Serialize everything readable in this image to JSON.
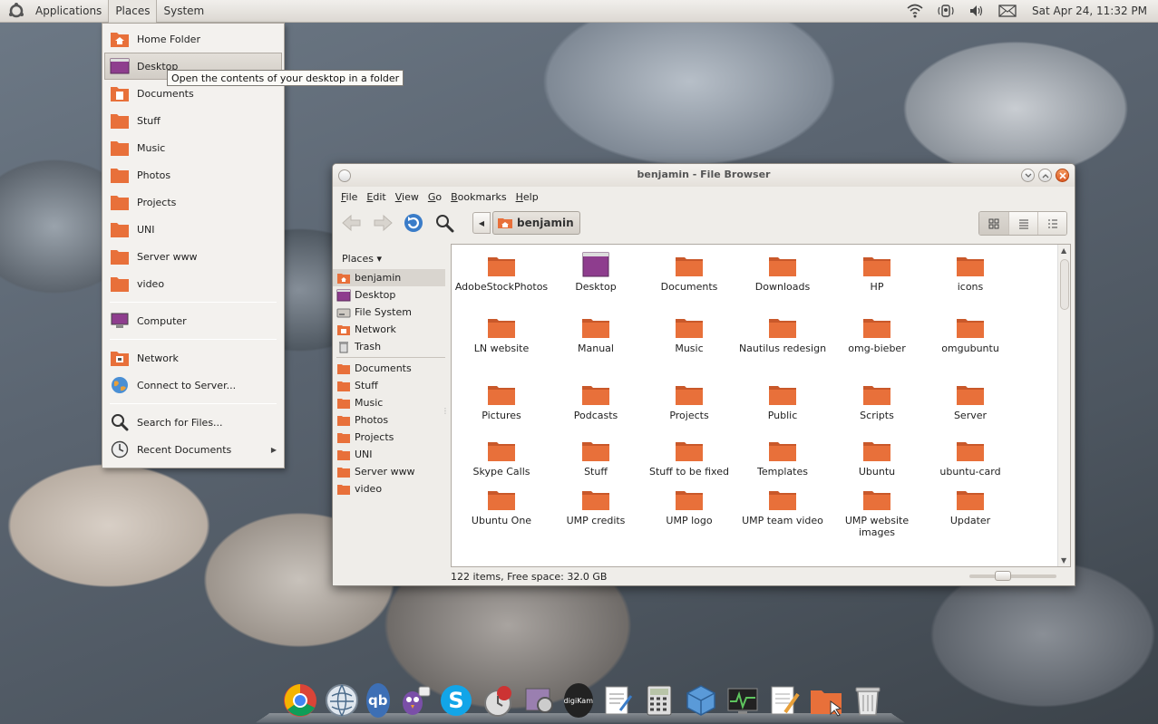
{
  "top_panel": {
    "menus": [
      "Applications",
      "Places",
      "System"
    ],
    "active_menu": "Places",
    "clock": "Sat Apr 24, 11:32 PM",
    "tray_icons": [
      "wifi-icon",
      "indicator-icon",
      "volume-icon",
      "mail-icon"
    ]
  },
  "places_menu": {
    "items": [
      {
        "label": "Home Folder",
        "icon": "home-folder-icon"
      },
      {
        "label": "Desktop",
        "icon": "desktop-icon"
      },
      {
        "label": "Documents",
        "icon": "folder-icon"
      },
      {
        "label": "Stuff",
        "icon": "folder-icon"
      },
      {
        "label": "Music",
        "icon": "folder-icon"
      },
      {
        "label": "Photos",
        "icon": "folder-icon"
      },
      {
        "label": "Projects",
        "icon": "folder-icon"
      },
      {
        "label": "UNI",
        "icon": "folder-icon"
      },
      {
        "label": "Server www",
        "icon": "folder-icon"
      },
      {
        "label": "video",
        "icon": "folder-icon"
      }
    ],
    "computer": "Computer",
    "network": "Network",
    "connect": "Connect to Server...",
    "search": "Search for Files...",
    "recent": "Recent Documents",
    "tooltip": "Open the contents of your desktop in a folder"
  },
  "file_browser": {
    "title": "benjamin - File Browser",
    "menubar": [
      {
        "key": "F",
        "rest": "ile"
      },
      {
        "key": "E",
        "rest": "dit"
      },
      {
        "key": "V",
        "rest": "iew"
      },
      {
        "key": "G",
        "rest": "o"
      },
      {
        "key": "B",
        "rest": "ookmarks"
      },
      {
        "key": "H",
        "rest": "elp"
      }
    ],
    "path": "benjamin",
    "side_header": "Places",
    "side_places": [
      "benjamin",
      "Desktop",
      "File System",
      "Network",
      "Trash"
    ],
    "side_bookmarks": [
      "Documents",
      "Stuff",
      "Music",
      "Photos",
      "Projects",
      "UNI",
      "Server www",
      "video"
    ],
    "status": "122 items, Free space: 32.0 GB",
    "files": [
      "AdobeStockPhotos",
      "Desktop",
      "Documents",
      "Downloads",
      "HP",
      "icons",
      "LN website",
      "Manual",
      "Music",
      "Nautilus redesign",
      "omg-bieber",
      "omgubuntu",
      "Pictures",
      "Podcasts",
      "Projects",
      "Public",
      "Scripts",
      "Server",
      "Skype Calls",
      "Stuff",
      "Stuff to be fixed",
      "Templates",
      "Ubuntu",
      "ubuntu-card",
      "Ubuntu One",
      "UMP credits",
      "UMP logo",
      "UMP team video",
      "UMP website images",
      "Updater"
    ]
  },
  "dock": {
    "apps": [
      "chrome-icon",
      "network-globe-icon",
      "qbittorrent-icon",
      "pidgin-icon",
      "skype-icon",
      "clock-app-icon",
      "screenshot-icon",
      "digikam-icon",
      "text-editor-icon",
      "calculator-icon",
      "virtualbox-icon",
      "system-monitor-icon",
      "notes-icon",
      "file-manager-icon",
      "trash-icon"
    ],
    "qb_label": "qb",
    "digikam_label": "digiKam"
  },
  "colors": {
    "folder_orange": "#e8703a",
    "desktop_purple": "#8e3d8e",
    "close_orange": "#dd5a23"
  }
}
